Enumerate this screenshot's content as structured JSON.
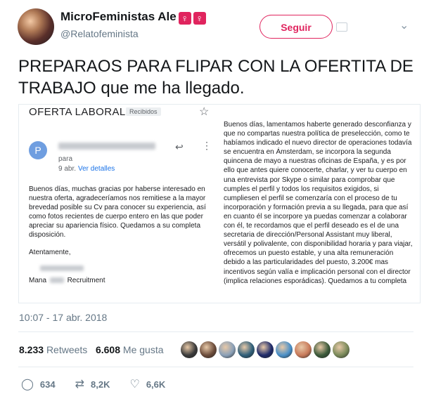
{
  "author": {
    "name": "MicroFeministas Ale",
    "emoji": [
      "♀",
      "♀"
    ],
    "handle": "@Relatofeminista"
  },
  "follow_label": "Seguir",
  "tweet_text": "PREPARAOS PARA FLIPAR CON LA OFERTITA DE TRABAJO que me ha llegado.",
  "email": {
    "subject": "OFERTA LABORAL.",
    "tag": "Recibidos",
    "sender_initial": "P",
    "to_label": "para",
    "time": "9 abr.",
    "details_label": "Ver detalles",
    "body_left": "Buenos días, muchas gracias por haberse interesado en nuestra oferta, agradeceríamos nos remitiese a la mayor brevedad posible su Cv para conocer su experiencia, así como fotos recientes de cuerpo entero en las que poder apreciar su apariencia físico. Quedamos a su completa disposición.",
    "closing": "Atentamente,",
    "signature_prefix": "Mana",
    "signature_suffix": "Recruitment",
    "body_right": "Buenos días, lamentamos haberte generado desconfianza y que no compartas nuestra política de preselección, como te habíamos indicado el nuevo director de operaciones todavía se encuentra en Ámsterdam, se incorpora la segunda quincena de mayo a nuestras oficinas de España, y es por ello que antes quiere conocerte, charlar, y ver tu cuerpo en una entrevista por Skype o similar para comprobar que cumples el perfil y todos los requisitos exigidos, si cumpliesen el perfil se comenzaría con el proceso de tu incorporación y formación previa a su llegada, para que así en cuanto él se incorpore ya puedas comenzar a colaborar con él, te recordamos que el perfil deseado es el de una secretaria de dirección/Personal Assistant muy liberal, versátil y polivalente, con disponibilidad horaria y para viajar, ofrecemos un puesto estable, y una alta remuneración debido a las particularidades del puesto, 3.200€ mas incentivos según valía e implicación personal con el director (implica relaciones esporádicas). Quedamos a tu completa"
  },
  "timestamp": "10:07 - 17 abr. 2018",
  "stats": {
    "retweets": "8.233",
    "retweets_label": "Retweets",
    "likes": "6.608",
    "likes_label": "Me gusta"
  },
  "liker_avatars": [
    "#3a3a3a",
    "#6b4b3a",
    "#8aa0b8",
    "#2f5f7a",
    "#1e2a6a",
    "#4a90c8",
    "#c87a5a",
    "#3b5a3a",
    "#7a8a5a"
  ],
  "actions": {
    "replies": "634",
    "retweets": "8,2K",
    "likes": "6,6K"
  }
}
